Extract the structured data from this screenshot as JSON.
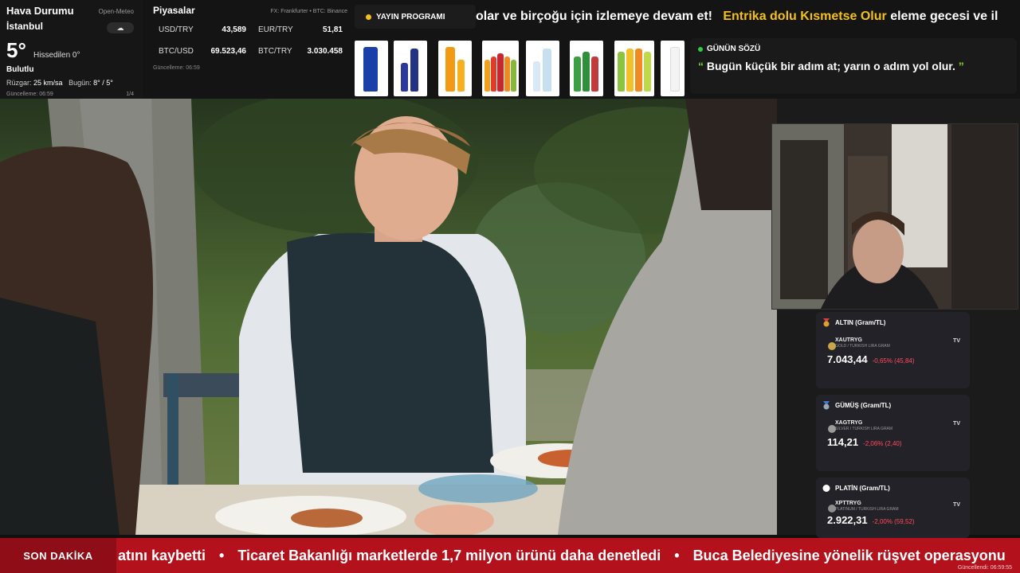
{
  "weather": {
    "title": "Hava Durumu",
    "source": "Open-Meteo",
    "city": "İstanbul",
    "temperature": "5°",
    "feels_like": "Hissedilen 0°",
    "condition": "Bulutlu",
    "wind_label": "Rüzgar:",
    "wind_value": "25 km/sa",
    "today_label": "Bugün:",
    "today_value": "8° / 5°",
    "updated": "Güncelleme: 06:59",
    "page": "1/4",
    "icon": "cloud-icon"
  },
  "markets": {
    "title": "Piyasalar",
    "source": "FX: Frankfurter • BTC: Binance",
    "rows": [
      {
        "label": "USD/TRY",
        "value": "43,589"
      },
      {
        "label": "EUR/TRY",
        "value": "51,81"
      },
      {
        "label": "BTC/USD",
        "value": "69.523,46"
      },
      {
        "label": "BTC/TRY",
        "value": "3.030.458"
      }
    ],
    "updated": "Güncelleme: 06:59"
  },
  "schedule": {
    "label": "YAYIN PROGRAMI"
  },
  "top_ticker": {
    "part1": "olar ve birçoğu için izlemeye devam et!",
    "highlight": "Entrika dolu Kısmetse Olur",
    "part2": "eleme gecesi ve il"
  },
  "quote": {
    "header": "GÜNÜN SÖZÜ",
    "open_mark": "“",
    "text": "Bugün küçük bir adım at; yarın o adım yol olur.",
    "close_mark": "”"
  },
  "commodities": [
    {
      "header": "ALTIN (Gram/TL)",
      "symbol": "XAUTRYG",
      "sub": "GOLD / TURKISH LIRA GRAM",
      "price": "7.043,44",
      "change": "-0,65% (45,84)",
      "medal_color": "#e0a12b",
      "coin_color": "#caa64a"
    },
    {
      "header": "GÜMÜŞ (Gram/TL)",
      "symbol": "XAGTRYG",
      "sub": "SILVER / TURKISH LIRA GRAM",
      "price": "114,21",
      "change": "-2,06% (2,40)",
      "medal_color": "#9aa7b8",
      "coin_color": "#9b9b9b"
    },
    {
      "header": "PLATİN (Gram/TL)",
      "symbol": "XPTTRYG",
      "sub": "PLATINUM / TURKISH LIRA GRAM",
      "price": "2.922,31",
      "change": "-2,00% (59,52)",
      "medal_color": "#ffffff",
      "coin_color": "#8e8e8e"
    }
  ],
  "tv_badge": "TV",
  "breaking": {
    "label": "SON DAKİKA",
    "items": [
      "atını kaybetti",
      "Ticaret Bakanlığı marketlerde 1,7 milyon ürünü daha denetledi",
      "Buca Belediyesine yönelik rüşvet operasyonu"
    ],
    "separator": "•",
    "updated": "Güncellendi: 06:59:55"
  },
  "colors": {
    "accent_yellow": "#f3c01a",
    "breaking_red": "#b3121d",
    "down_red": "#ff4d5f",
    "quote_green": "#7cd43a"
  }
}
